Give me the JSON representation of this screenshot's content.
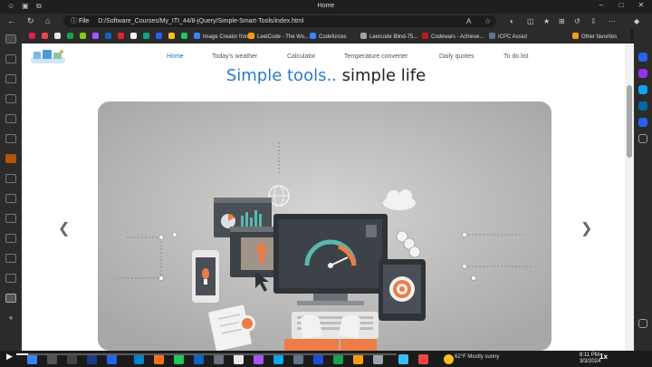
{
  "browser": {
    "tab_title": "Home",
    "url_prefix": "File",
    "url": "D:/Software_Courses/My_ITI_44/8-jQuery/Simple-Smart-Tools/index.html",
    "favorites": [
      {
        "label": "Image Creator from...",
        "color": "#3b82f6"
      },
      {
        "label": "LeetCode - The Wo...",
        "color": "#f59e0b"
      },
      {
        "label": "Codeforces",
        "color": "#3b82f6"
      },
      {
        "label": "Leetcode Blind-75...",
        "color": "#9ca3af"
      },
      {
        "label": "Codewars - Achieve...",
        "color": "#b91c1c"
      },
      {
        "label": "ICPC Assiut",
        "color": "#64748b"
      }
    ],
    "other_favorites": "Other favorites"
  },
  "site": {
    "nav": [
      "Home",
      "Today's weather",
      "Calculator",
      "Temperature converter",
      "Daily quotes",
      "To do list"
    ],
    "active_nav": "Home",
    "headline_accent": "Simple tools..",
    "headline_rest": " simple life"
  },
  "carousel": {
    "prev_icon": "chevron-left-icon",
    "next_icon": "chevron-right-icon"
  },
  "player": {
    "speed": "1x",
    "progress": 0.03
  },
  "taskbar": {
    "weather_temp": "62°F",
    "weather_desc": "Mostly sunny",
    "time": "8:11 PM",
    "date": "3/3/2024"
  },
  "colors": {
    "accent": "#2a7cc7",
    "browser_bg": "#2b2b2b",
    "carousel_bg": "#bdbcbb"
  }
}
